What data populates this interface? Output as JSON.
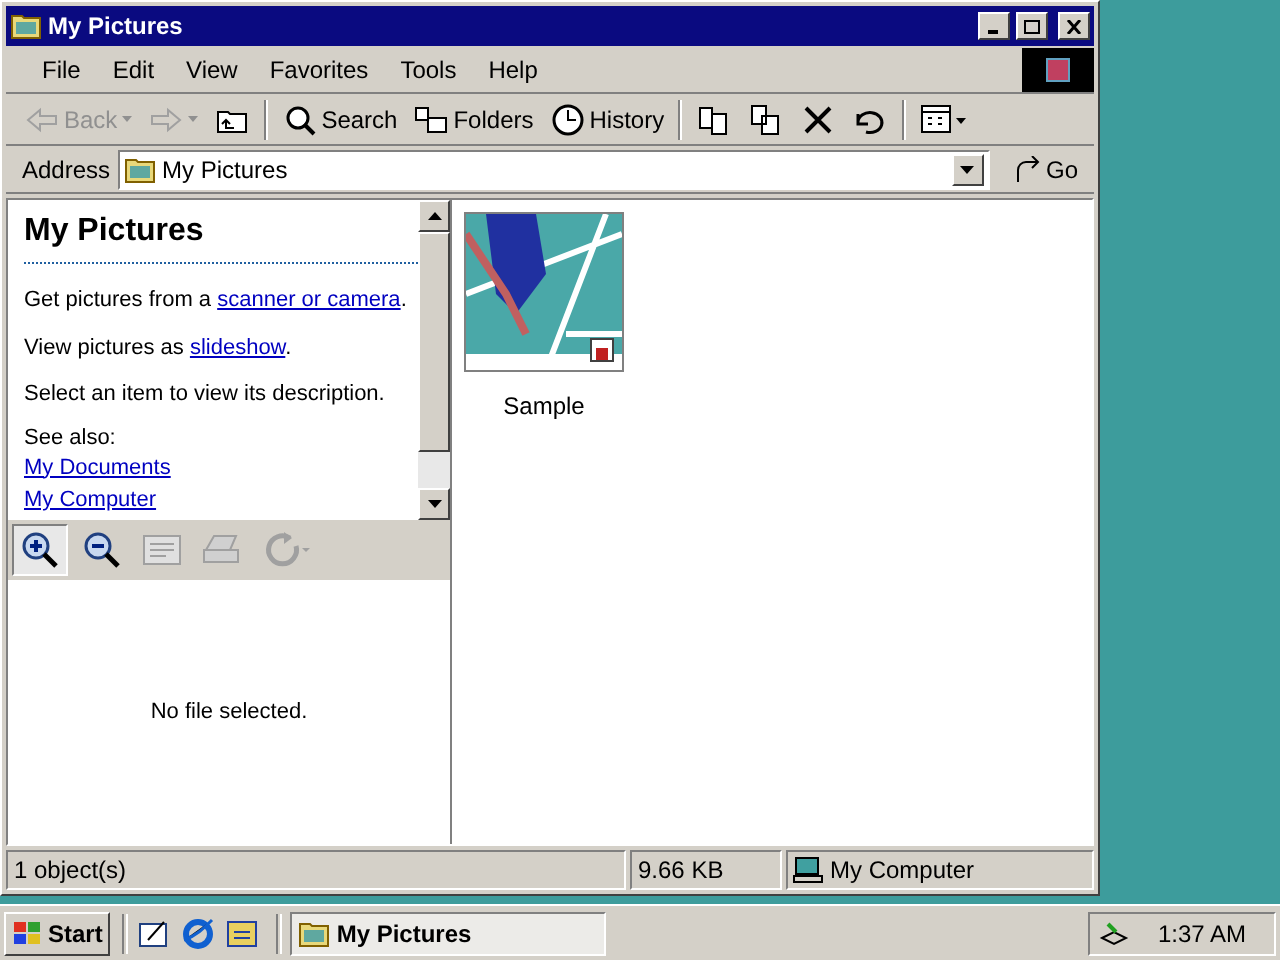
{
  "window": {
    "title": "My Pictures"
  },
  "menu": [
    "File",
    "Edit",
    "View",
    "Favorites",
    "Tools",
    "Help"
  ],
  "toolbar": [
    {
      "kind": "back",
      "label": "Back",
      "disabled": true
    },
    {
      "kind": "forward",
      "disabled": true
    },
    {
      "kind": "up",
      "disabled": false
    },
    {
      "kind": "search",
      "label": "Search",
      "disabled": false
    },
    {
      "kind": "folders",
      "label": "Folders",
      "disabled": false
    },
    {
      "kind": "history",
      "label": "History",
      "disabled": false
    },
    {
      "kind": "move",
      "disabled": false
    },
    {
      "kind": "copy",
      "disabled": false
    },
    {
      "kind": "delete",
      "disabled": false
    },
    {
      "kind": "undo",
      "disabled": false
    },
    {
      "kind": "views",
      "disabled": false
    }
  ],
  "address": {
    "label": "Address",
    "value": "My Pictures",
    "go": "Go"
  },
  "info_pane": {
    "title": "My Pictures",
    "lines": [
      {
        "before": "Get pictures from a ",
        "link": "scanner or camera",
        "after": "."
      },
      {
        "before": "View pictures as ",
        "link": "slideshow",
        "after": "."
      },
      {
        "before": "Select an item to view its description."
      }
    ],
    "see_also": "See also:",
    "links": [
      "My Documents",
      "My Computer"
    ]
  },
  "preview_toolbar": [
    {
      "kind": "zoom-in",
      "selected": true,
      "disabled": false
    },
    {
      "kind": "zoom-out",
      "selected": false,
      "disabled": false
    },
    {
      "kind": "fit",
      "selected": false,
      "disabled": true
    },
    {
      "kind": "print",
      "selected": false,
      "disabled": true
    },
    {
      "kind": "rotate",
      "selected": false,
      "disabled": true
    }
  ],
  "preview": {
    "message": "No file selected."
  },
  "files": [
    {
      "name": "Sample"
    }
  ],
  "status_bar": {
    "objects": "1 object(s)",
    "size": "9.66 KB",
    "zone": "My Computer"
  },
  "taskbar": {
    "start": "Start",
    "tasks": [
      {
        "title": "My Pictures",
        "selected": true
      }
    ],
    "clock": "1:37 AM"
  }
}
